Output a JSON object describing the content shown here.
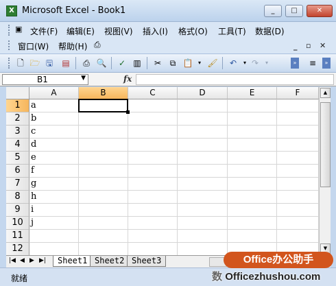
{
  "window": {
    "title": "Microsoft Excel - Book1",
    "app_icon": "X"
  },
  "menu": {
    "row1": [
      "文件(F)",
      "编辑(E)",
      "视图(V)",
      "插入(I)",
      "格式(O)",
      "工具(T)",
      "数据(D)"
    ],
    "row2": [
      "窗口(W)",
      "帮助(H)"
    ]
  },
  "formula_bar": {
    "name_box": "B1",
    "fx": "fx",
    "formula": ""
  },
  "grid": {
    "columns": [
      "A",
      "B",
      "C",
      "D",
      "E",
      "F"
    ],
    "rows": [
      "1",
      "2",
      "3",
      "4",
      "5",
      "6",
      "7",
      "8",
      "9",
      "10",
      "11",
      "12"
    ],
    "col_a_values": [
      "a",
      "b",
      "c",
      "d",
      "e",
      "f",
      "g",
      "h",
      "i",
      "j",
      "",
      ""
    ],
    "selected_cell": "B1"
  },
  "sheets": [
    "Sheet1",
    "Sheet2",
    "Sheet3"
  ],
  "status": {
    "text": "就绪",
    "partial_right": "数"
  },
  "watermark": {
    "badge": "Office办公助手",
    "site_prefix": "数",
    "site": "Officezhushou.com"
  },
  "colors": {
    "selection_header": "#f6b65c",
    "watermark": "#d2551d"
  }
}
